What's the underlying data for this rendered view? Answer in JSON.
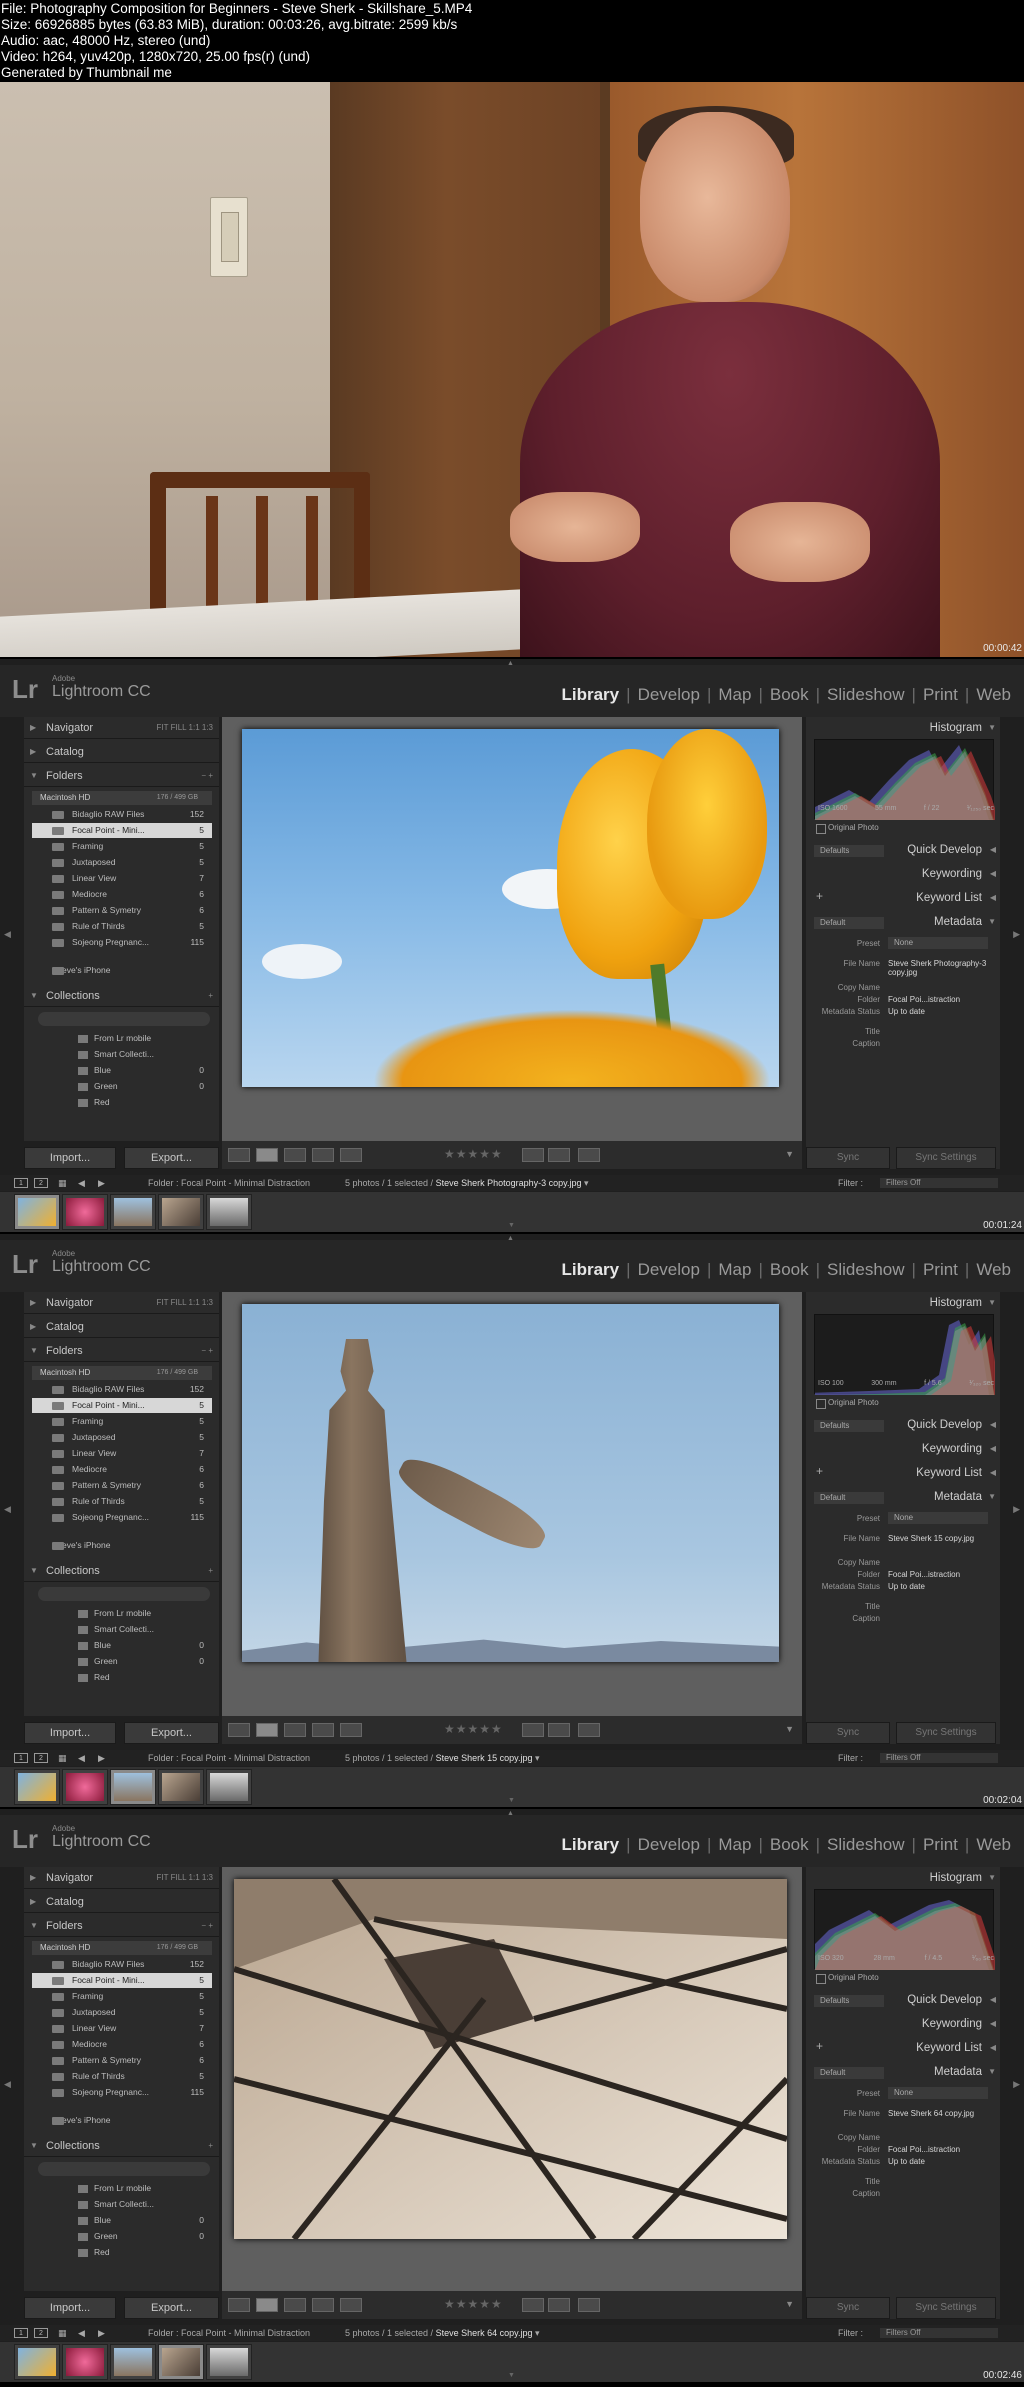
{
  "header": {
    "line1": "File: Photography Composition for Beginners - Steve Sherk - Skillshare_5.MP4",
    "line2": "Size: 66926885 bytes (63.83 MiB), duration: 00:03:26, avg.bitrate: 2599 kb/s",
    "line3": "Audio: aac, 48000 Hz, stereo (und)",
    "line4": "Video: h264, yuv420p, 1280x720, 25.00 fps(r) (und)",
    "line5": "Generated by Thumbnail me"
  },
  "timestamps": [
    "00:00:42",
    "00:01:24",
    "00:02:04",
    "00:02:46"
  ],
  "lightroom": {
    "adobe": "Adobe",
    "product": "Lightroom CC",
    "logo": "Lr",
    "modules": [
      "Library",
      "Develop",
      "Map",
      "Book",
      "Slideshow",
      "Print",
      "Web"
    ],
    "active_module": "Library",
    "left_panel": {
      "navigator": "Navigator",
      "nav_zoom": "FIT  FILL  1:1  1:3",
      "catalog": "Catalog",
      "folders": "Folders",
      "volume": "Macintosh HD",
      "volume_cap": "176 / 499 GB",
      "folder_items": [
        {
          "name": "Bidaglio RAW Files",
          "count": "152"
        },
        {
          "name": "Focal Point - Mini...",
          "count": "5"
        },
        {
          "name": "Framing",
          "count": "5"
        },
        {
          "name": "Juxtaposed",
          "count": "5"
        },
        {
          "name": "Linear View",
          "count": "7"
        },
        {
          "name": "Mediocre",
          "count": "6"
        },
        {
          "name": "Pattern & Symetry",
          "count": "6"
        },
        {
          "name": "Rule of Thirds",
          "count": "5"
        },
        {
          "name": "Sojeong Pregnanc...",
          "count": "115"
        }
      ],
      "iphone": "Steve's iPhone",
      "collections": "Collections",
      "collection_items": [
        {
          "name": "From Lr mobile",
          "count": ""
        },
        {
          "name": "Smart Collecti...",
          "count": ""
        },
        {
          "name": "Blue",
          "count": "0"
        },
        {
          "name": "Green",
          "count": "0"
        },
        {
          "name": "Red",
          "count": ""
        }
      ],
      "import_label": "Import...",
      "export_label": "Export..."
    },
    "right_panel": {
      "histogram": "Histogram",
      "original_photo": "Original Photo",
      "defaults": "Defaults",
      "quick_develop": "Quick Develop",
      "keywording": "Keywording",
      "keyword_list": "Keyword List",
      "default": "Default",
      "metadata": "Metadata",
      "preset_label": "Preset",
      "preset_value": "None",
      "file_name_label": "File Name",
      "copy_name_label": "Copy Name",
      "folder_label": "Folder",
      "metadata_status_label": "Metadata Status",
      "title_label": "Title",
      "caption_label": "Caption",
      "sync_label": "Sync",
      "sync_settings_label": "Sync Settings"
    },
    "filmstrip": {
      "folder": "Folder : Focal Point - Minimal Distraction",
      "count": "5 photos / 1 selected /",
      "filter_label": "Filter :",
      "filter_value": "Filters Off"
    },
    "screens": [
      {
        "file": "Steve Sherk Photography-3 copy.jpg",
        "meta_file": "Steve Sherk Photography-3 copy.jpg",
        "folder_value": "Focal Poi...istraction",
        "status": "Up to date",
        "iso": "ISO 1600",
        "focal": "55 mm",
        "aperture": "f / 22",
        "shutter": "¹⁄₁₂₅₀ sec",
        "selected": 0
      },
      {
        "file": "Steve Sherk 15 copy.jpg",
        "meta_file": "Steve Sherk 15 copy.jpg",
        "folder_value": "Focal Poi...istraction",
        "status": "Up to date",
        "iso": "ISO 100",
        "focal": "300 mm",
        "aperture": "f / 5.6",
        "shutter": "¹⁄₃₂₀ sec",
        "selected": 2
      },
      {
        "file": "Steve Sherk 64 copy.jpg",
        "meta_file": "Steve Sherk 64 copy.jpg",
        "folder_value": "Focal Poi...istraction",
        "status": "Up to date",
        "iso": "ISO 320",
        "focal": "28 mm",
        "aperture": "f / 4.5",
        "shutter": "¹⁄₆₀ sec",
        "selected": 3
      }
    ]
  }
}
